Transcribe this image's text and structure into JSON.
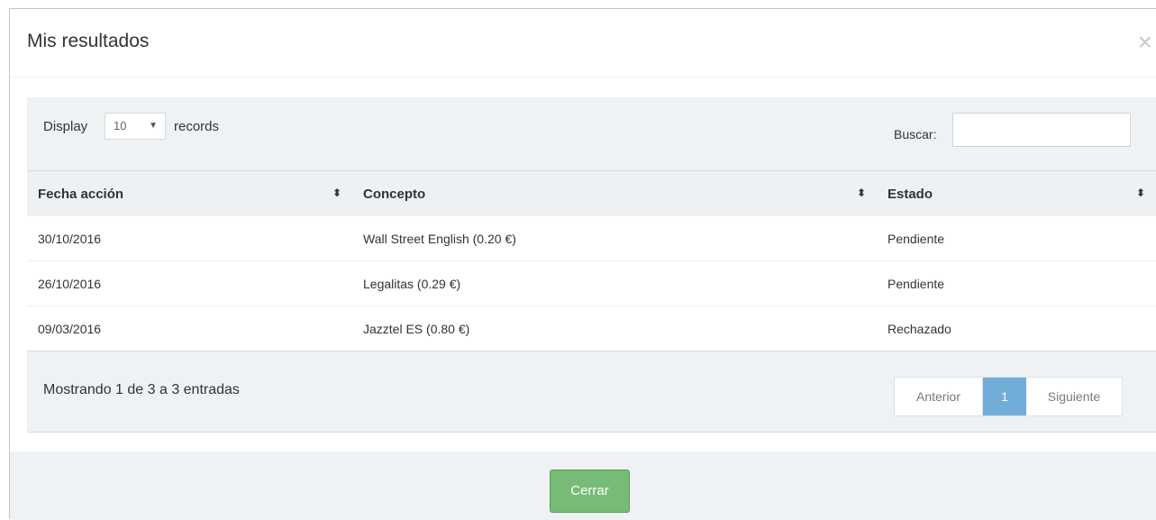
{
  "modal": {
    "title": "Mis resultados",
    "close_symbol": "×",
    "close_button_label": "Cerrar"
  },
  "controls": {
    "display_label": "Display",
    "length_value": "10",
    "length_arrow": "▼",
    "records_label": "records",
    "search_label": "Buscar:",
    "search_value": ""
  },
  "table": {
    "columns": [
      "Fecha acción",
      "Concepto",
      "Estado"
    ],
    "sort_symbol": "⬍",
    "rows": [
      [
        "30/10/2016",
        "Wall Street English (0.20 €)",
        "Pendiente"
      ],
      [
        "26/10/2016",
        "Legalitas (0.29 €)",
        "Pendiente"
      ],
      [
        "09/03/2016",
        "Jazztel ES (0.80 €)",
        "Rechazado"
      ]
    ]
  },
  "info": "Mostrando 1 de 3 a 3 entradas",
  "pagination": {
    "prev": "Anterior",
    "current": "1",
    "next": "Siguiente"
  },
  "colors": {
    "panel_bg": "#eef2f5",
    "active_page": "#72acd9",
    "close_button": "#77bb77"
  }
}
